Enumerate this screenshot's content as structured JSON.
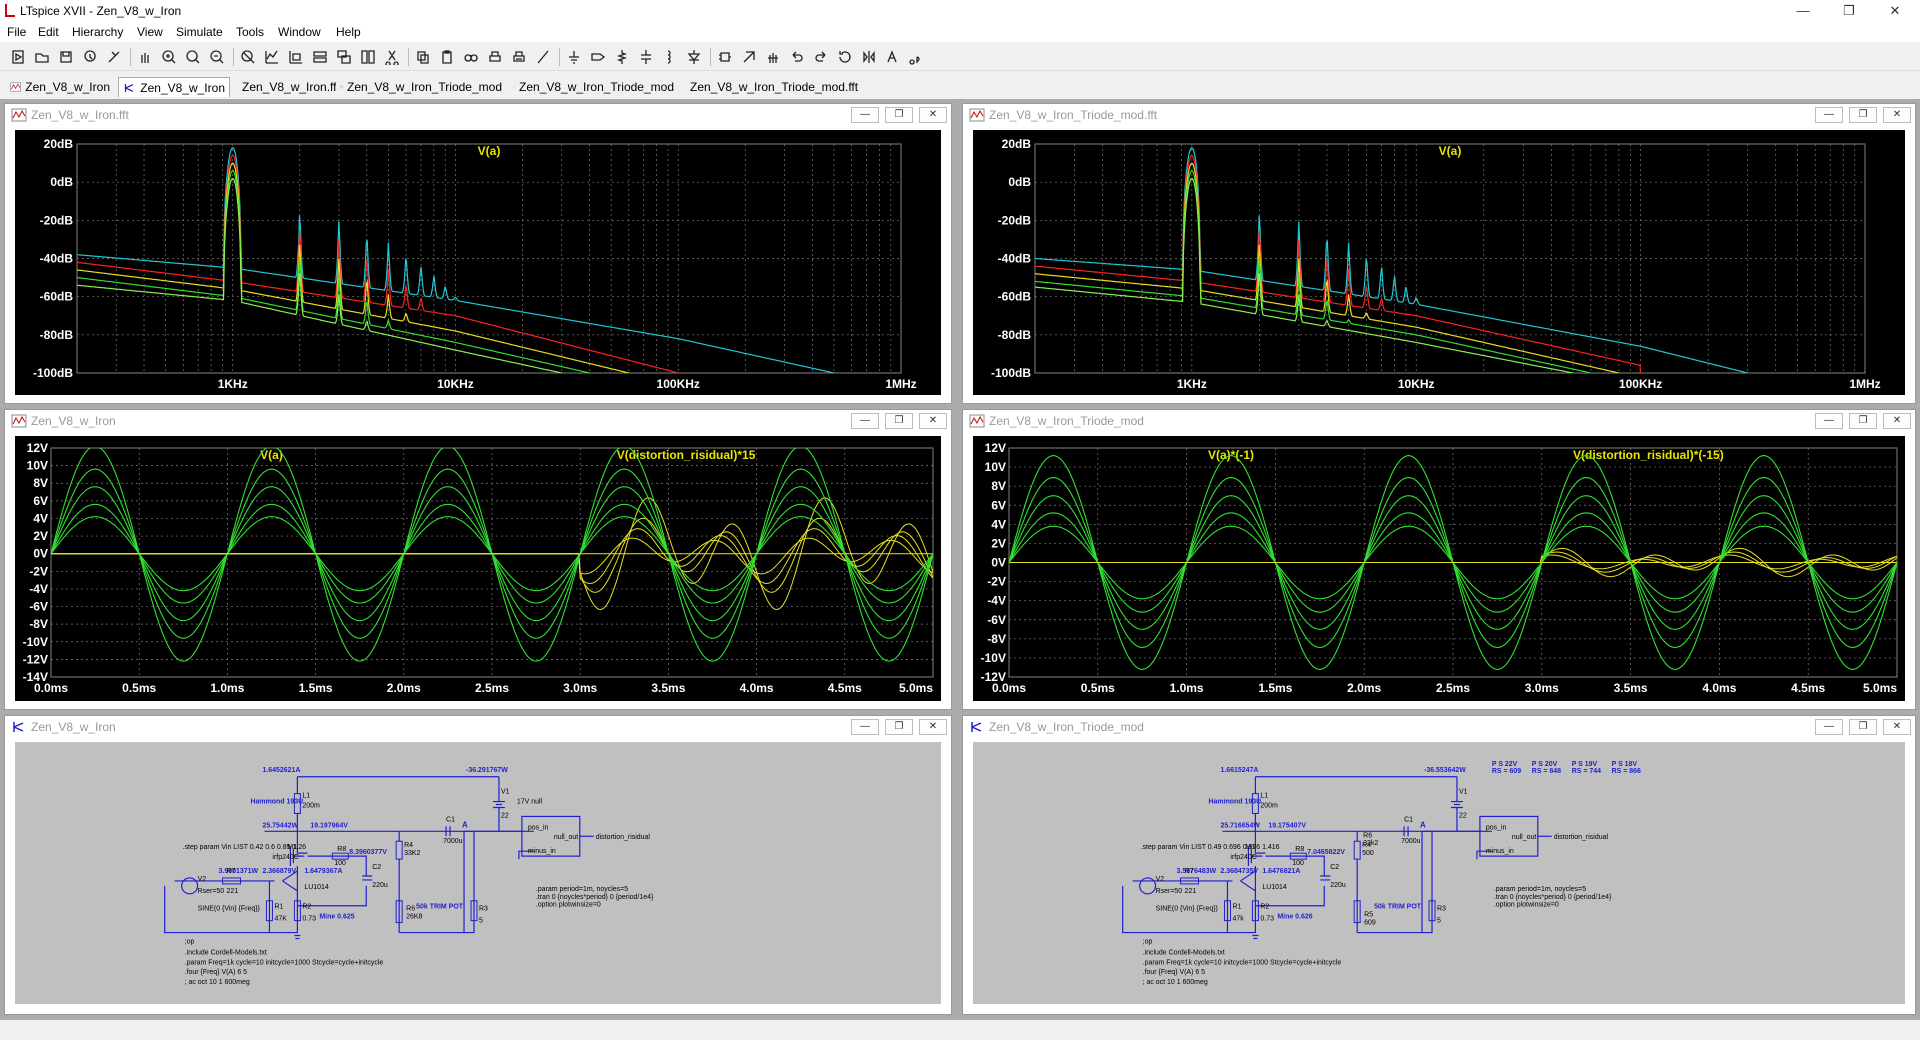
{
  "app": {
    "title": "LTspice XVII - Zen_V8_w_Iron"
  },
  "window_controls": {
    "minimize": "—",
    "restore": "❐",
    "close": "✕"
  },
  "menu": [
    "File",
    "Edit",
    "Hierarchy",
    "View",
    "Simulate",
    "Tools",
    "Window",
    "Help"
  ],
  "toolbar_icons": [
    "run-icon",
    "open-icon",
    "save-icon",
    "control-panel-icon",
    "halt-icon",
    "hand-icon",
    "zoom-in-icon",
    "zoom-area-icon",
    "zoom-out-icon",
    "zoom-fit-icon",
    "autorange-icon",
    "manual-limits-icon",
    "tile-horizontal-icon",
    "cascade-icon",
    "tile-vertical-icon",
    "cut-icon",
    "copy-icon",
    "paste-icon",
    "find-icon",
    "print-setup-icon",
    "print-icon",
    "wire-icon",
    "ground-icon",
    "label-icon",
    "resistor-icon",
    "capacitor-icon",
    "inductor-icon",
    "diode-icon",
    "component-icon",
    "move-icon",
    "drag-icon",
    "undo-icon",
    "redo-icon",
    "rotate-icon",
    "mirror-icon",
    "text-icon",
    "spice-directive-icon"
  ],
  "tabs": [
    {
      "label": "Zen_V8_w_Iron",
      "kind": "plot",
      "active": false
    },
    {
      "label": "Zen_V8_w_Iron",
      "kind": "schematic",
      "active": true
    },
    {
      "label": "Zen_V8_w_Iron.fft",
      "kind": "plot",
      "active": false
    },
    {
      "label": "Zen_V8_w_Iron_Triode_mod",
      "kind": "plot",
      "active": false
    },
    {
      "label": "Zen_V8_w_Iron_Triode_mod",
      "kind": "schematic",
      "active": false
    },
    {
      "label": "Zen_V8_w_Iron_Triode_mod.fft",
      "kind": "plot",
      "active": false
    }
  ],
  "windows": {
    "fft_left": {
      "title": "Zen_V8_w_Iron.fft"
    },
    "fft_right": {
      "title": "Zen_V8_w_Iron_Triode_mod.fft"
    },
    "tran_left": {
      "title": "Zen_V8_w_Iron"
    },
    "tran_right": {
      "title": "Zen_V8_w_Iron_Triode_mod"
    },
    "sch_left": {
      "title": "Zen_V8_w_Iron"
    },
    "sch_right": {
      "title": "Zen_V8_w_Iron_Triode_mod"
    }
  },
  "colors": {
    "trace_cyan": "#22c8d8",
    "trace_red": "#ff2020",
    "trace_yellow": "#e8e020",
    "trace_green": "#30e030",
    "trace_lime": "#8ef050",
    "trace_magenta": "#e040e0",
    "label_yellow": "#e6e600",
    "grid": "#7a7a7a",
    "schematic_text": "#1f1fd0"
  },
  "chart_data": [
    {
      "id": "fft_left",
      "type": "line",
      "title": "V(a)",
      "x_scale": "log",
      "xlim": [
        200,
        1000000
      ],
      "x_ticks": [
        "1KHz",
        "10KHz",
        "100KHz",
        "1MHz"
      ],
      "y_ticks": [
        "20dB",
        "0dB",
        "-20dB",
        "-40dB",
        "-60dB",
        "-80dB",
        "-100dB"
      ],
      "ylim": [
        -100,
        20
      ],
      "fundamental_hz": 1000,
      "fundamental_peaks_db": [
        18,
        14,
        10,
        6,
        2
      ],
      "harmonic_envelope": "even and odd harmonics decaying; noise floor sloping from about -38dB at 200Hz down to -100dB",
      "series": [
        {
          "color": "trace_cyan",
          "floor_db": [
            [
              200,
              -38
            ],
            [
              1000,
              -45
            ],
            [
              10000,
              -62
            ],
            [
              100000,
              -82
            ],
            [
              500000,
              -100
            ]
          ]
        },
        {
          "color": "trace_red",
          "floor_db": [
            [
              200,
              -42
            ],
            [
              1000,
              -52
            ],
            [
              10000,
              -70
            ],
            [
              100000,
              -100
            ]
          ]
        },
        {
          "color": "trace_yellow",
          "floor_db": [
            [
              200,
              -46
            ],
            [
              1000,
              -56
            ],
            [
              10000,
              -78
            ],
            [
              60000,
              -100
            ]
          ]
        },
        {
          "color": "trace_green",
          "floor_db": [
            [
              200,
              -50
            ],
            [
              1000,
              -60
            ],
            [
              10000,
              -84
            ],
            [
              40000,
              -100
            ]
          ]
        },
        {
          "color": "trace_lime",
          "floor_db": [
            [
              200,
              -54
            ],
            [
              1000,
              -62
            ],
            [
              10000,
              -88
            ],
            [
              30000,
              -100
            ]
          ]
        }
      ]
    },
    {
      "id": "fft_right",
      "type": "line",
      "title": "V(a)",
      "x_scale": "log",
      "xlim": [
        200,
        1000000
      ],
      "x_ticks": [
        "1KHz",
        "10KHz",
        "100KHz",
        "1MHz"
      ],
      "y_ticks": [
        "20dB",
        "0dB",
        "-20dB",
        "-40dB",
        "-60dB",
        "-80dB",
        "-100dB"
      ],
      "ylim": [
        -100,
        20
      ],
      "fundamental_hz": 1000,
      "fundamental_peaks_db": [
        18,
        14,
        10,
        6,
        2
      ],
      "series": [
        {
          "color": "trace_cyan",
          "floor_db": [
            [
              200,
              -40
            ],
            [
              1000,
              -46
            ],
            [
              10000,
              -64
            ],
            [
              100000,
              -86
            ],
            [
              300000,
              -100
            ]
          ]
        },
        {
          "color": "trace_red",
          "floor_db": [
            [
              200,
              -44
            ],
            [
              1000,
              -52
            ],
            [
              10000,
              -70
            ],
            [
              100000,
              -96
            ]
          ]
        },
        {
          "color": "trace_yellow",
          "floor_db": [
            [
              200,
              -48
            ],
            [
              1000,
              -56
            ],
            [
              10000,
              -76
            ],
            [
              80000,
              -100
            ]
          ]
        },
        {
          "color": "trace_green",
          "floor_db": [
            [
              200,
              -52
            ],
            [
              1000,
              -60
            ],
            [
              10000,
              -80
            ],
            [
              60000,
              -100
            ]
          ]
        },
        {
          "color": "trace_lime",
          "floor_db": [
            [
              200,
              -55
            ],
            [
              1000,
              -63
            ],
            [
              10000,
              -84
            ],
            [
              50000,
              -100
            ]
          ]
        }
      ]
    },
    {
      "id": "tran_left",
      "type": "line",
      "legend": [
        {
          "text": "V(a)",
          "color": "label_yellow"
        },
        {
          "text": "V(distortion_risidual)*15",
          "color": "label_yellow"
        }
      ],
      "x_unit": "ms",
      "xlim": [
        0,
        5
      ],
      "x_ticks": [
        "0.0ms",
        "0.5ms",
        "1.0ms",
        "1.5ms",
        "2.0ms",
        "2.5ms",
        "3.0ms",
        "3.5ms",
        "4.0ms",
        "4.5ms",
        "5.0ms"
      ],
      "y_ticks": [
        "12V",
        "10V",
        "8V",
        "6V",
        "4V",
        "2V",
        "0V",
        "-2V",
        "-4V",
        "-6V",
        "-8V",
        "-10V",
        "-12V",
        "-14V"
      ],
      "ylim": [
        -14,
        12
      ],
      "frequency_khz": 1,
      "amplitudes_v": [
        12.2,
        9.6,
        7.6,
        5.6,
        4.2
      ],
      "residual_visible_from_ms": 3.0,
      "residual_amplitude_v": [
        6,
        4,
        3,
        2
      ],
      "invert": false
    },
    {
      "id": "tran_right",
      "type": "line",
      "legend": [
        {
          "text": "V(a)*(-1)",
          "color": "label_yellow"
        },
        {
          "text": "V(distortion_risidual)*(-15)",
          "color": "label_yellow"
        }
      ],
      "x_unit": "ms",
      "xlim": [
        0,
        5
      ],
      "x_ticks": [
        "0.0ms",
        "0.5ms",
        "1.0ms",
        "1.5ms",
        "2.0ms",
        "2.5ms",
        "3.0ms",
        "3.5ms",
        "4.0ms",
        "4.5ms",
        "5.0ms"
      ],
      "y_ticks": [
        "12V",
        "10V",
        "8V",
        "6V",
        "4V",
        "2V",
        "0V",
        "-2V",
        "-4V",
        "-6V",
        "-8V",
        "-10V",
        "-12V"
      ],
      "ylim": [
        -12,
        12
      ],
      "frequency_khz": 1,
      "amplitudes_v": [
        11.2,
        8.9,
        7.0,
        5.2,
        3.8
      ],
      "residual_visible_from_ms": 3.0,
      "residual_amplitude_v": [
        1.4,
        1.0,
        0.7
      ],
      "invert": true
    }
  ],
  "schematic_left": {
    "labels": {
      "i1": "1.6452621A",
      "p1": "-36.291767W",
      "v1": "V1",
      "v1v": "22",
      "v1n": "17V null",
      "l1": "L1",
      "l1v": "200m",
      "hammond": "Hammond 193U",
      "p2": "25.75442W",
      "p3": "19.197964V",
      "c1": "C1",
      "c1v": "7000u",
      "a": "A",
      "pos": "pos_in",
      "nullout": "null_out",
      "dres": "distortion_risidual",
      "minus": "minus_in",
      "r4": "R4",
      "r4v": "33K2",
      "step": ".step param Vin LIST 0.42 0.6 0.85 1.26",
      "m1": "M1",
      "m1p": "irfp240C",
      "r8": "R8",
      "r8v": "100",
      "v8": "8.3960377V",
      "v9": "3.9001371W",
      "v10": "2.366879V",
      "a2": "1.6479367A",
      "c2": "C2",
      "c2v": "220u",
      "r7": "R7",
      "r7v": "221",
      "j": "LU1014",
      "p1l": ".param period=1m, noycles=5",
      "p2l": ".tran 0 {noycles*period} 0 {period/1e4}",
      "p3l": ".option plotwinsize=0",
      "v2": "V2",
      "rser": "Rser=50",
      "sine": "SINE(0 {Vin} {Freq})",
      "r1": "R1",
      "r1v": "47K",
      "r2": "R2",
      "r2v": "0.73",
      "r6": "R6",
      "r6v": "26K8",
      "trim": "50k TRIM POT",
      "mine": "Mine 0.625",
      "r3": "R3",
      "r3v": "5",
      "op": ";op",
      "inc": ".include Cordell-Models.txt",
      "param": ".param Freq=1k cycle=10 initcycle=1000 Stcycle=cycle+initcycle",
      "four": ".four {Freq} V(A) 6 5",
      "ac": "; ac oct 10 1 600meg"
    }
  },
  "schematic_right": {
    "labels": {
      "i1": "1.6615247A",
      "p1": "-36.553642W",
      "v1": "V1",
      "v1v": "22",
      "ps1": "P S 22V",
      "rs1": "RS = 609",
      "ps2": "P S 20V",
      "rs2": "RS = 848",
      "ps3": "P S 19V",
      "rs3": "RS = 744",
      "ps4": "P S 18V",
      "rs4": "RS = 866",
      "l1": "L1",
      "l1v": "200m",
      "hammond": "Hammond 193U",
      "p2": "25.716654W",
      "p3": "19.175407V",
      "c1": "C1",
      "c1v": "7000u",
      "a": "A",
      "pos": "pos_in",
      "nullout": "null_out",
      "dres": "distortion_risidual",
      "minus": "minus_in",
      "r4": "R4",
      "r4v": "500",
      "r6": "R6",
      "r6v": "33k2",
      "step": ".step param Vin LIST 0.49 0.696 0.976 1.416",
      "m1": "M1",
      "m1p": "irfp240C",
      "r8": "R8",
      "r8v": "100",
      "v8": "7.0465822V",
      "v9": "3.5976483W",
      "v10": "2.3684735V",
      "a2": "1.6476821A",
      "c2": "C2",
      "c2v": "220u",
      "r7": "R7",
      "r7v": "221",
      "j": "LU1014",
      "p1l": ".param period=1m, noycles=5",
      "p2l": ".tran 0 {noycles*period} 0 {period/1e4}",
      "p3l": ".option plotwinsize=0",
      "v2": "V2",
      "rser": "Rser=50",
      "sine": "SINE(0 {Vin} {Freq})",
      "r1": "R1",
      "r1v": "47k",
      "r2": "R2",
      "r2v": "0.73",
      "r5": "R5",
      "r5v": "609",
      "trim": "50k TRIM POT",
      "mine": "Mine 0.626",
      "r3": "R3",
      "r3v": "5",
      "op": ";op",
      "inc": ".include Cordell-Models.txt",
      "param": ".param Freq=1k cycle=10 initcycle=1000 Stcycle=cycle+initcycle",
      "four": ".four {Freq} V(A) 6 5",
      "ac": "; ac oct 10 1 600meg"
    }
  }
}
